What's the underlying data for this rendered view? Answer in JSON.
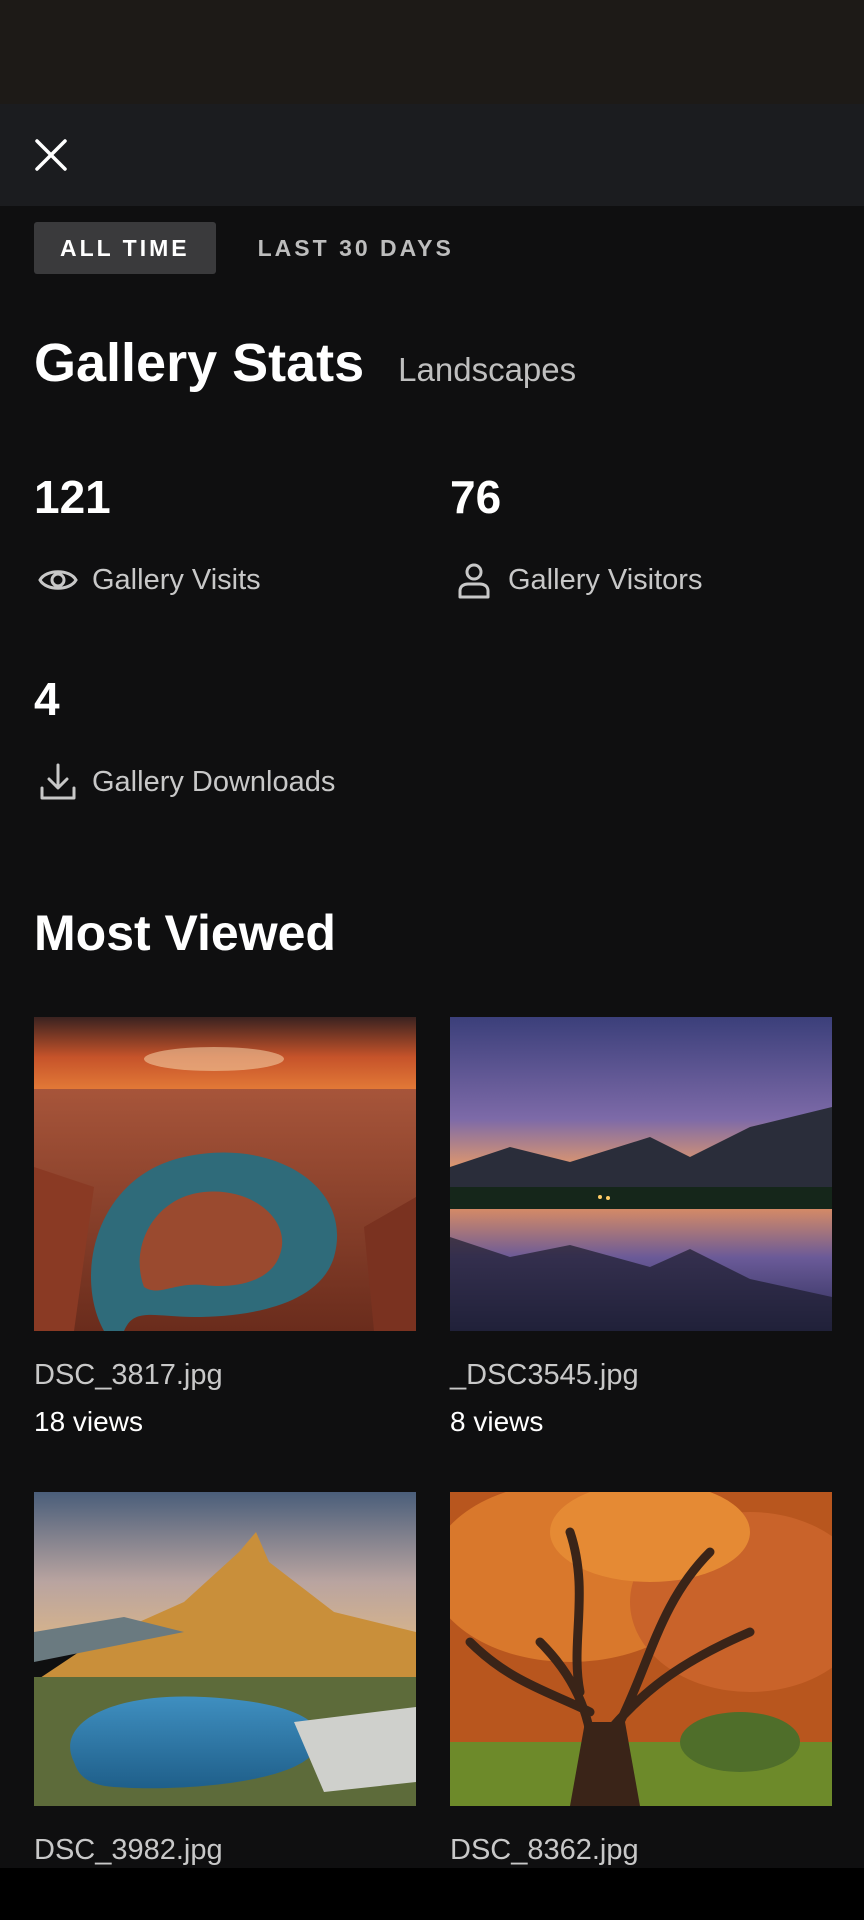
{
  "header": {
    "close_icon": "close-icon"
  },
  "tabs": [
    {
      "label": "ALL TIME",
      "active": true
    },
    {
      "label": "LAST 30 DAYS",
      "active": false
    }
  ],
  "title": "Gallery Stats",
  "gallery_name": "Landscapes",
  "stats": {
    "visits": {
      "value": "121",
      "label": "Gallery Visits",
      "icon": "eye-icon"
    },
    "visitors": {
      "value": "76",
      "label": "Gallery Visitors",
      "icon": "person-icon"
    },
    "downloads": {
      "value": "4",
      "label": "Gallery Downloads",
      "icon": "download-icon"
    }
  },
  "most_viewed": {
    "title": "Most Viewed",
    "items": [
      {
        "name": "DSC_3817.jpg",
        "views": "18 views"
      },
      {
        "name": "_DSC3545.jpg",
        "views": "8 views"
      },
      {
        "name": "DSC_3982.jpg",
        "views": ""
      },
      {
        "name": "DSC_8362.jpg",
        "views": ""
      }
    ]
  },
  "colors": {
    "background": "#0f0f10",
    "top_bar": "#1b1c1f",
    "active_tab": "#3a3a3c",
    "secondary_text": "#c8c8c8"
  }
}
